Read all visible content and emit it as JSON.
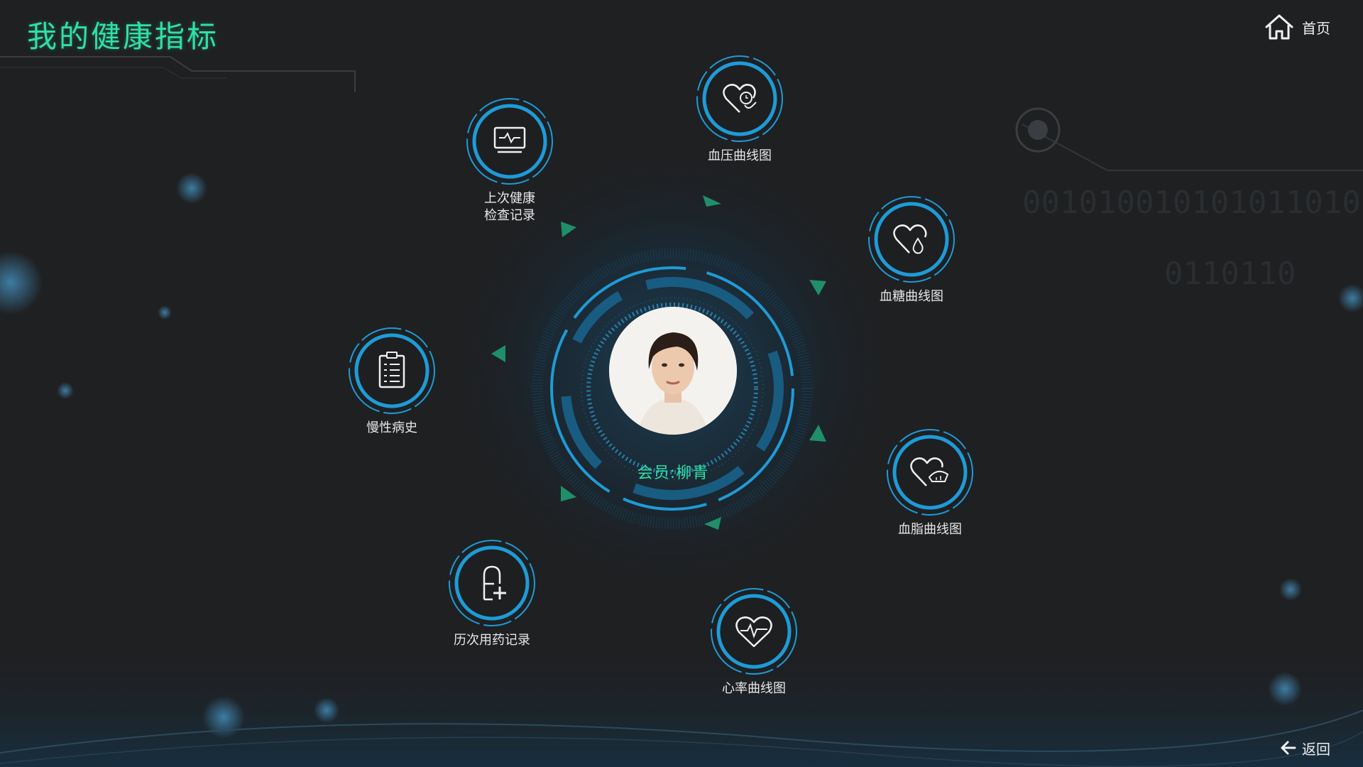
{
  "header": {
    "title": "我的健康指标",
    "home_label": "首页"
  },
  "footer": {
    "back_label": "返回"
  },
  "member": {
    "label": "会员:柳青"
  },
  "menu": {
    "checkup": "上次健康\n检查记录",
    "bp": "血压曲线图",
    "sugar": "血糖曲线图",
    "lipid": "血脂曲线图",
    "heart": "心率曲线图",
    "meds": "历次用药记录",
    "chronic": "慢性病史"
  },
  "colors": {
    "accent": "#2fe0a6",
    "ring": "#1e9bd7",
    "background": "#1f2022"
  },
  "icons": {
    "home": "home-icon",
    "back": "arrow-left-icon",
    "checkup": "monitor-pulse-icon",
    "bp": "heart-pressure-icon",
    "sugar": "heart-drop-icon",
    "lipid": "heart-gauge-icon",
    "heart": "heart-pulse-icon",
    "meds": "capsule-plus-icon",
    "chronic": "clipboard-icon"
  }
}
